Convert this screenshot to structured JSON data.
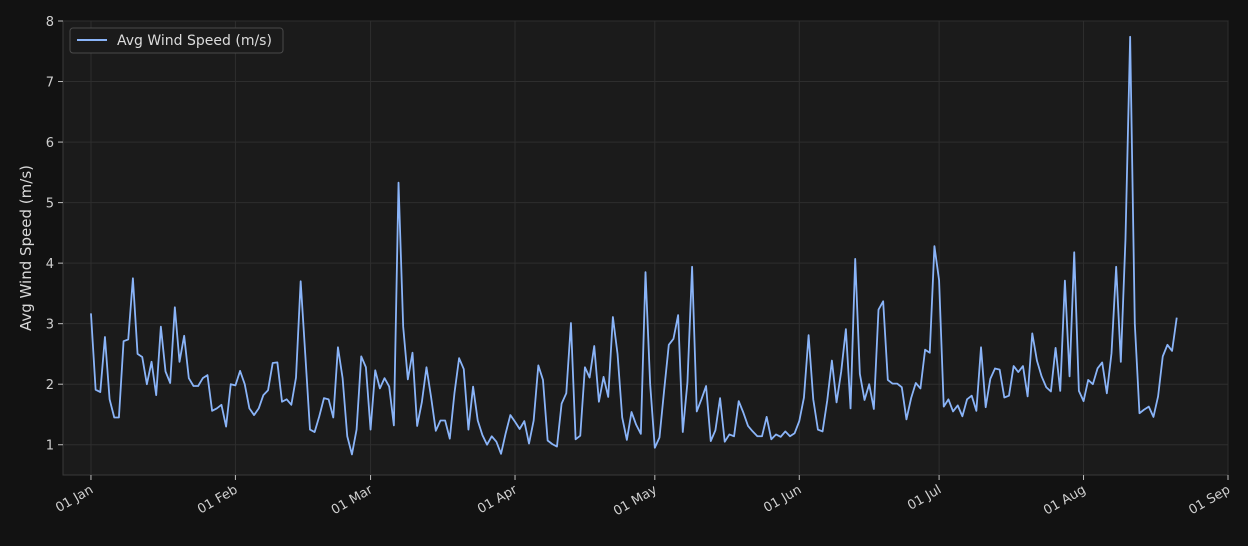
{
  "chart_data": {
    "type": "line",
    "title": "",
    "xlabel": "",
    "ylabel": "Avg Wind Speed (m/s)",
    "start_date": "2024-01-01",
    "xlim": [
      "2023-12-26",
      "2024-09-01"
    ],
    "ylim": [
      0.5,
      8
    ],
    "x_ticks": [
      "01 Jan",
      "01 Feb",
      "01 Mar",
      "01 Apr",
      "01 May",
      "01 Jun",
      "01 Jul",
      "01 Aug",
      "01 Sep"
    ],
    "y_ticks": [
      1,
      2,
      3,
      4,
      5,
      6,
      7,
      8
    ],
    "grid": true,
    "legend": "top-left",
    "series": [
      {
        "name": "Avg Wind Speed (m/s)",
        "color": "#8ab4f8",
        "values": [
          3.17,
          1.91,
          1.87,
          2.78,
          1.75,
          1.45,
          1.45,
          2.71,
          2.74,
          3.75,
          2.5,
          2.45,
          2.0,
          2.37,
          1.82,
          2.95,
          2.21,
          2.02,
          3.27,
          2.37,
          2.8,
          2.1,
          1.97,
          1.97,
          2.1,
          2.15,
          1.56,
          1.6,
          1.66,
          1.3,
          2.0,
          1.98,
          2.22,
          2.0,
          1.6,
          1.49,
          1.6,
          1.82,
          1.9,
          2.35,
          2.36,
          1.71,
          1.75,
          1.66,
          2.11,
          3.7,
          2.48,
          1.25,
          1.21,
          1.47,
          1.77,
          1.75,
          1.45,
          2.61,
          2.1,
          1.14,
          0.84,
          1.25,
          2.46,
          2.28,
          1.25,
          2.23,
          1.93,
          2.1,
          1.96,
          1.32,
          5.33,
          2.95,
          2.08,
          2.52,
          1.31,
          1.7,
          2.28,
          1.78,
          1.23,
          1.4,
          1.4,
          1.1,
          1.85,
          2.43,
          2.25,
          1.25,
          1.96,
          1.4,
          1.16,
          1.0,
          1.14,
          1.05,
          0.85,
          1.19,
          1.49,
          1.38,
          1.26,
          1.39,
          1.02,
          1.4,
          2.31,
          2.07,
          1.07,
          1.01,
          0.97,
          1.68,
          1.85,
          3.01,
          1.09,
          1.15,
          2.28,
          2.11,
          2.63,
          1.71,
          2.12,
          1.79,
          3.11,
          2.5,
          1.45,
          1.08,
          1.54,
          1.33,
          1.18,
          3.85,
          2.0,
          0.95,
          1.12,
          1.9,
          2.65,
          2.75,
          3.14,
          1.21,
          2.03,
          3.94,
          1.55,
          1.75,
          1.97,
          1.06,
          1.24,
          1.77,
          1.05,
          1.17,
          1.14,
          1.72,
          1.53,
          1.31,
          1.22,
          1.14,
          1.14,
          1.46,
          1.09,
          1.17,
          1.13,
          1.22,
          1.14,
          1.19,
          1.39,
          1.78,
          2.81,
          1.75,
          1.25,
          1.22,
          1.73,
          2.39,
          1.7,
          2.21,
          2.91,
          1.6,
          4.07,
          2.17,
          1.74,
          2.0,
          1.59,
          3.23,
          3.37,
          2.07,
          2.01,
          2.01,
          1.95,
          1.42,
          1.77,
          2.02,
          1.93,
          2.57,
          2.52,
          4.28,
          3.72,
          1.63,
          1.75,
          1.55,
          1.65,
          1.47,
          1.75,
          1.81,
          1.56,
          2.61,
          1.62,
          2.09,
          2.26,
          2.24,
          1.78,
          1.81,
          2.3,
          2.2,
          2.3,
          1.8,
          2.84,
          2.39,
          2.13,
          1.95,
          1.88,
          2.6,
          1.89,
          3.71,
          2.13,
          4.18,
          1.89,
          1.72,
          2.07,
          2.0,
          2.26,
          2.36,
          1.85,
          2.51,
          3.94,
          2.37,
          4.4,
          7.74,
          3.0,
          1.52,
          1.58,
          1.63,
          1.46,
          1.8,
          2.46,
          2.65,
          2.55,
          3.1
        ]
      }
    ]
  }
}
